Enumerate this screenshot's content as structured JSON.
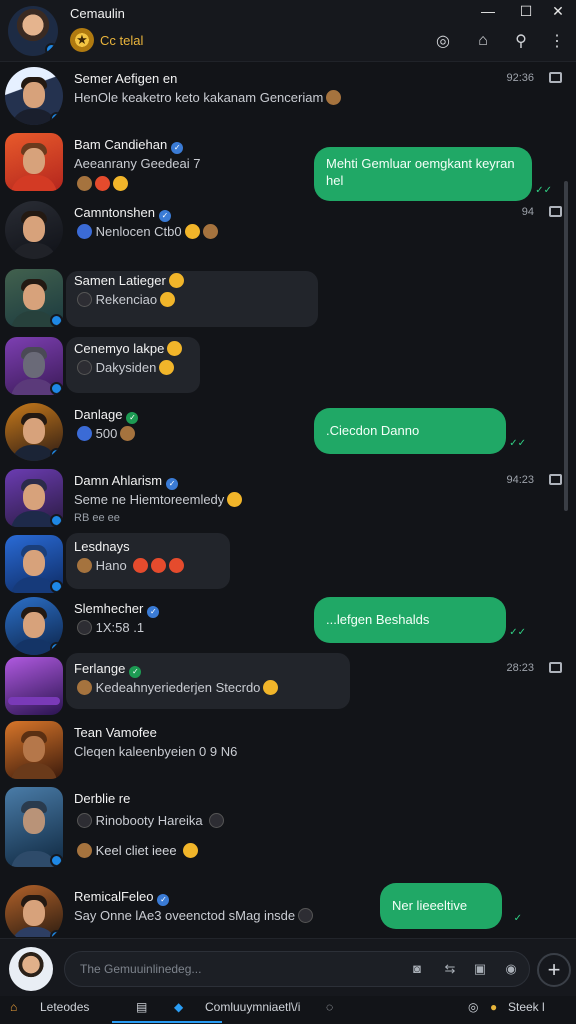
{
  "titlebar": {
    "title": "Cemaulin",
    "chip_label": "Cc telal",
    "window_controls": {
      "minimize": "—",
      "maximize": "☐",
      "close": "✕"
    },
    "actions": [
      "status-icon",
      "new-chat-icon",
      "search-icon",
      "menu-icon"
    ]
  },
  "chats": [
    {
      "name": "Semer Aefigen en",
      "preview": "HenOle keaketro keto kakanam Genceriam",
      "time": "92:36",
      "avatar_colors": [
        "#24324f",
        "#e6f0ff"
      ]
    },
    {
      "name": "Bam Candiehan",
      "preview": "Aeeanrany Geedeai 7",
      "extra": "",
      "avatar_colors": [
        "#b4261e",
        "#e85a2b"
      ],
      "outgoing": "Mehti Gemluar oemgkant keyran hel"
    },
    {
      "name": "Camntonshen",
      "preview": "Nenlocen Ctb0",
      "time": "94",
      "avatar_colors": [
        "#0f1117",
        "#2a2d35"
      ]
    },
    {
      "name": "Samen Latieger",
      "preview": "Rekenciao",
      "avatar_colors": [
        "#1b3a3f",
        "#42614e"
      ]
    },
    {
      "name": "Cenemyo lakpe",
      "preview": "Dakysiden",
      "avatar_colors": [
        "#3a1a56",
        "#7d3fb2"
      ]
    },
    {
      "name": "Danlage",
      "preview": "500",
      "avatar_colors": [
        "#2b1a14",
        "#c77a1b"
      ],
      "outgoing": ".Ciecdon  Danno"
    },
    {
      "name": "Damn Ahlarism",
      "preview": "Seme ne Hiemtoreemledy",
      "extra": "RB ee ee",
      "time": "94:23",
      "avatar_colors": [
        "#2a1b40",
        "#6b3cb2"
      ]
    },
    {
      "name": "Lesdnays",
      "preview": "Hano",
      "avatar_colors": [
        "#0e2b63",
        "#2a6bd6"
      ]
    },
    {
      "name": "Slemhecher",
      "preview": "1X:58 .1",
      "avatar_colors": [
        "#0c2348",
        "#2c70c8"
      ],
      "outgoing": "...lefgen  Beshalds"
    },
    {
      "name": "Ferlange",
      "preview": "Kedeahnyeriederjen  Stecrdo",
      "time": "28:23",
      "avatar_colors": [
        "#2a1450",
        "#b05ae0"
      ]
    },
    {
      "name": "Tean Vamofee",
      "preview": "Cleqen kaleenbyeien 0 9 N6",
      "avatar_colors": [
        "#3b1a0c",
        "#d8762a"
      ]
    },
    {
      "name": "Derblie re",
      "preview": "Rinobooty Hareika",
      "extra": "Keel cliet ieee",
      "avatar_colors": [
        "#0f2840",
        "#4a7ca8"
      ]
    },
    {
      "name": "RemicalFeleo",
      "preview": "Say Onne lAe3 oveenctod sMag  insde",
      "avatar_colors": [
        "#24180f",
        "#b2622a"
      ],
      "outgoing": "Ner lieeeltive"
    }
  ],
  "composer": {
    "placeholder": "The Gemuuinlinedeg...",
    "icons": [
      "sticker-icon",
      "format-icon",
      "media-icon",
      "emoji-icon"
    ],
    "plus_label": "+"
  },
  "bottombar": {
    "left_label": "Leteodes",
    "center_label": "Comluuymniaetl\\/i",
    "right_label": "Steek l"
  }
}
